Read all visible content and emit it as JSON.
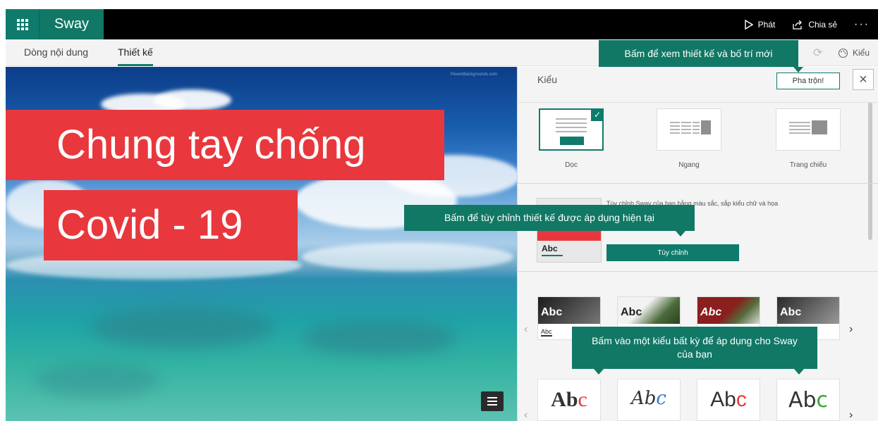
{
  "app": {
    "name": "Sway",
    "play_label": "Phát",
    "share_label": "Chia sẻ",
    "more_label": "···"
  },
  "tabs": [
    {
      "label": "Dòng nội dung",
      "active": false
    },
    {
      "label": "Thiết kế",
      "active": true
    }
  ],
  "style_button_label": "Kiểu",
  "canvas": {
    "line1": "Chung tay chống",
    "line2": "Covid - 19",
    "watermark": "PexelsBackgrounds.com"
  },
  "pane": {
    "title": "Kiểu",
    "remix_label": "Pha trộn!",
    "close_label": "×",
    "layouts": [
      {
        "label": "Dọc",
        "selected": true
      },
      {
        "label": "Ngang",
        "selected": false
      },
      {
        "label": "Trang chiếu",
        "selected": false
      }
    ],
    "customize_desc": "Tùy chỉnh Sway của bạn bằng màu sắc, sắp kiểu chữ và họa",
    "customize_thumb_text": "Abc",
    "customize_button": "Tùy chỉnh",
    "style_cards": [
      {
        "text": "Abc",
        "sub": "Abc",
        "text_color": "#ffffff",
        "photo": "#3b3b3b"
      },
      {
        "text": "Abc",
        "sub": "Abc",
        "text_color": "#222222",
        "photo": "#e8e8e8"
      },
      {
        "text": "Abc",
        "sub": "Abc",
        "text_color": "#ffffff",
        "photo": "#8b1e1e"
      },
      {
        "text": "Abc",
        "sub": "Abc",
        "text_color": "#ffffff",
        "photo": "#5a5a5a"
      }
    ],
    "font_cards": [
      {
        "main": "Ab",
        "accent": "c",
        "accent_color": "#e8383d"
      },
      {
        "main": "Ab",
        "accent": "c",
        "accent_color": "#2b7bd0"
      },
      {
        "main": "Ab",
        "accent": "c",
        "accent_color": "#e8383d"
      },
      {
        "main": "Ab",
        "accent": "c",
        "accent_color": "#3aa33a"
      }
    ],
    "prev_label": "‹",
    "next_label": "›"
  },
  "tooltips": {
    "design": "Bấm để xem thiết kế và bố trí mới",
    "customize": "Bấm để tùy chỉnh thiết kế được áp dụng hiện tại",
    "style": "Bấm vào một kiểu bất kỳ để áp dụng cho Sway của bạn"
  },
  "colors": {
    "accent": "#0f7b6c",
    "caption_red": "#e8383d"
  }
}
